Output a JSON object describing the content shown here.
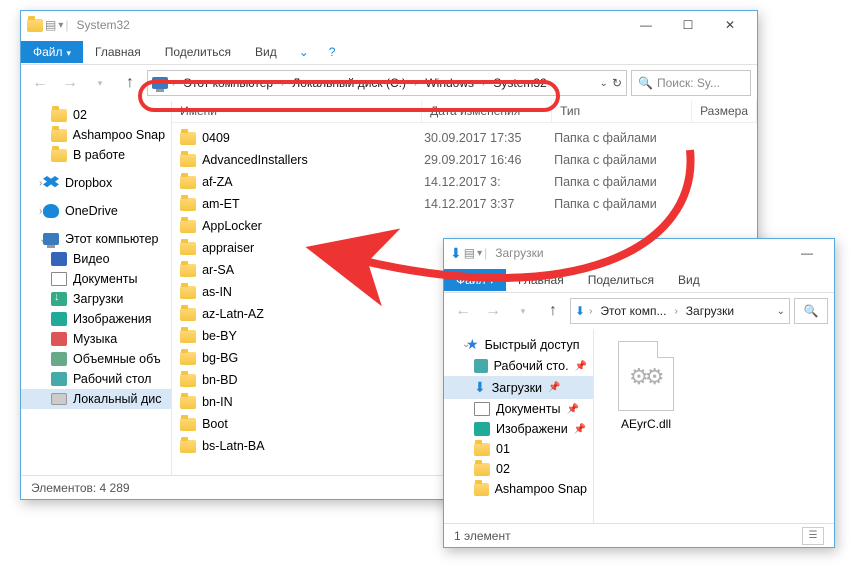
{
  "win1": {
    "title": "System32",
    "tabs": {
      "file": "Файл",
      "home": "Главная",
      "share": "Поделиться",
      "view": "Вид"
    },
    "breadcrumb": [
      "Этот компьютер",
      "Локальный диск (C:)",
      "Windows",
      "System32"
    ],
    "search_placeholder": "Поиск: Sy...",
    "columns": {
      "name": "Имени",
      "date": "Дата изменения",
      "type": "Тип",
      "size": "Размера"
    },
    "sidebar": [
      {
        "label": "02",
        "icon": "folder"
      },
      {
        "label": "Ashampoo Snap",
        "icon": "folder"
      },
      {
        "label": "В работе",
        "icon": "folder"
      },
      {
        "sep": true
      },
      {
        "label": "Dropbox",
        "icon": "dropbox",
        "header": true
      },
      {
        "sep": true
      },
      {
        "label": "OneDrive",
        "icon": "onedrive",
        "header": true
      },
      {
        "sep": true
      },
      {
        "label": "Этот компьютер",
        "icon": "pc",
        "header": true,
        "expanded": true
      },
      {
        "label": "Видео",
        "icon": "video"
      },
      {
        "label": "Документы",
        "icon": "doc"
      },
      {
        "label": "Загрузки",
        "icon": "down"
      },
      {
        "label": "Изображения",
        "icon": "img"
      },
      {
        "label": "Музыка",
        "icon": "music"
      },
      {
        "label": "Объемные объ",
        "icon": "cube"
      },
      {
        "label": "Рабочий стол",
        "icon": "desk"
      },
      {
        "label": "Локальный дис",
        "icon": "disk",
        "selected": true
      }
    ],
    "files": [
      {
        "name": "0409",
        "date": "30.09.2017 17:35",
        "type": "Папка с файлами"
      },
      {
        "name": "AdvancedInstallers",
        "date": "29.09.2017 16:46",
        "type": "Папка с файлами"
      },
      {
        "name": "af-ZA",
        "date": "14.12.2017 3:",
        "type": "Папка с файлами"
      },
      {
        "name": "am-ET",
        "date": "14.12.2017 3:37",
        "type": "Папка с файлами"
      },
      {
        "name": "AppLocker",
        "date": "",
        "type": ""
      },
      {
        "name": "appraiser",
        "date": "",
        "type": ""
      },
      {
        "name": "ar-SA",
        "date": "",
        "type": ""
      },
      {
        "name": "as-IN",
        "date": "",
        "type": ""
      },
      {
        "name": "az-Latn-AZ",
        "date": "",
        "type": ""
      },
      {
        "name": "be-BY",
        "date": "",
        "type": ""
      },
      {
        "name": "bg-BG",
        "date": "",
        "type": ""
      },
      {
        "name": "bn-BD",
        "date": "",
        "type": ""
      },
      {
        "name": "bn-IN",
        "date": "",
        "type": ""
      },
      {
        "name": "Boot",
        "date": "",
        "type": ""
      },
      {
        "name": "bs-Latn-BA",
        "date": "",
        "type": ""
      }
    ],
    "status": "Элементов: 4 289"
  },
  "win2": {
    "title": "Загрузки",
    "tabs": {
      "file": "Файл",
      "home": "Главная",
      "share": "Поделиться",
      "view": "Вид"
    },
    "breadcrumb": [
      "Этот комп...",
      "Загрузки"
    ],
    "search_icon": "search",
    "sidebar": [
      {
        "label": "Быстрый доступ",
        "icon": "star",
        "header": true,
        "expanded": true
      },
      {
        "label": "Рабочий сто.",
        "icon": "desk",
        "pinned": true
      },
      {
        "label": "Загрузки",
        "icon": "dl",
        "pinned": true,
        "selected": true
      },
      {
        "label": "Документы",
        "icon": "doc",
        "pinned": true
      },
      {
        "label": "Изображени",
        "icon": "img",
        "pinned": true
      },
      {
        "label": "01",
        "icon": "folder"
      },
      {
        "label": "02",
        "icon": "folder"
      },
      {
        "label": "Ashampoo Snap",
        "icon": "folder"
      }
    ],
    "file": {
      "name": "AEyrC.dll"
    },
    "status": "1 элемент"
  }
}
